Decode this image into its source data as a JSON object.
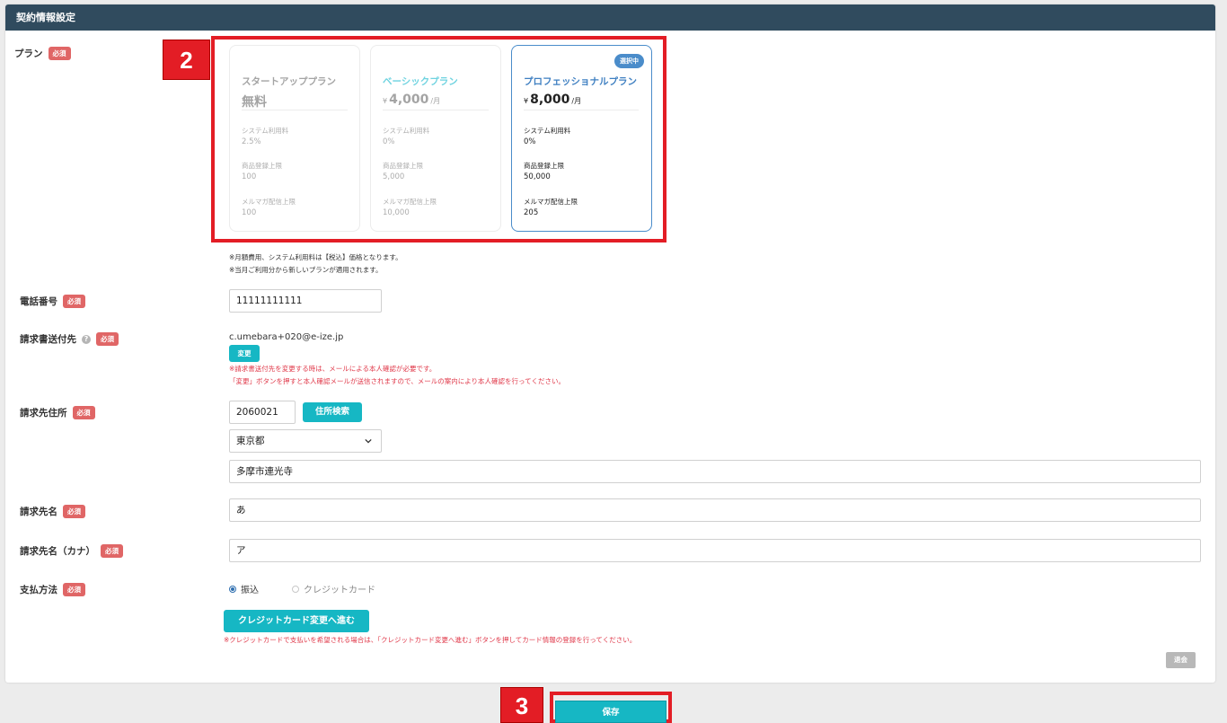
{
  "header": {
    "title": "契約情報設定"
  },
  "labels": {
    "plan": "プラン",
    "phone": "電話番号",
    "invoice_email": "請求書送付先",
    "billing_address": "請求先住所",
    "billing_name": "請求先名",
    "billing_name_kana": "請求先名（カナ）",
    "payment_method": "支払方法",
    "required": "必須",
    "help": "?"
  },
  "annotations": {
    "step2": "2",
    "step3": "3"
  },
  "plans": [
    {
      "name": "スタートアッププラン",
      "price": "無料",
      "attr1": "システム利用料",
      "val1": "2.5%",
      "attr2": "商品登録上限",
      "val2": "100",
      "attr3": "メルマガ配信上限",
      "val3": "100"
    },
    {
      "name": "ベーシックプラン",
      "currency": "¥",
      "price": "4,000",
      "per": "/月",
      "attr1": "システム利用料",
      "val1": "0%",
      "attr2": "商品登録上限",
      "val2": "5,000",
      "attr3": "メルマガ配信上限",
      "val3": "10,000"
    },
    {
      "name": "プロフェッショナルプラン",
      "currency": "¥",
      "price": "8,000",
      "per": "/月",
      "badge": "選択中",
      "attr1": "システム利用料",
      "val1": "0%",
      "attr2": "商品登録上限",
      "val2": "50,000",
      "attr3": "メルマガ配信上限",
      "val3": "205"
    }
  ],
  "plan_notes": {
    "line1": "※月額費用、システム利用料は【税込】価格となります。",
    "line2": "※当月ご利用分から新しいプランが適用されます。"
  },
  "phone": {
    "value": "11111111111"
  },
  "invoice": {
    "email": "c.umebara+020@e-ize.jp",
    "change_label": "変更",
    "note1": "※請求書送付先を変更する時は、メールによる本人確認が必要です。",
    "note2": "「変更」ボタンを押すと本人確認メールが送信されますので、メールの案内により本人確認を行ってください。"
  },
  "address": {
    "postal": "2060021",
    "search_label": "住所検索",
    "prefecture": "東京都",
    "city": "多摩市連光寺"
  },
  "billing_name": {
    "value": "あ"
  },
  "billing_name_kana": {
    "value": "ア"
  },
  "payment": {
    "option1": "振込",
    "option2": "クレジットカード",
    "selected": "振込",
    "card_button": "クレジットカード変更へ進む",
    "note": "※クレジットカードで支払いを希望される場合は、「クレジットカード変更へ進む」ボタンを押してカード情報の登録を行ってください。"
  },
  "withdraw_label": "退会",
  "save_label": "保存",
  "colors": {
    "header_bg": "#304b5e",
    "accent": "#16b7c4",
    "required": "#e06666",
    "highlight": "#e31d25",
    "selected_plan": "#4a8cca"
  }
}
